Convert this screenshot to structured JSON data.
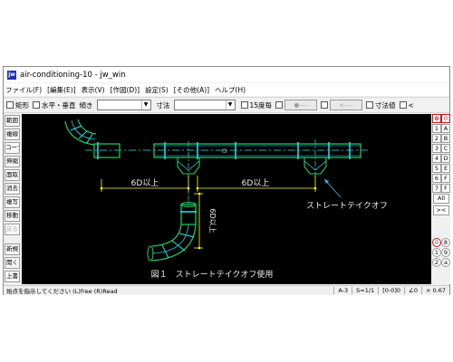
{
  "window": {
    "title": "air-conditioning-10 - jw_win",
    "icon_text": "jw"
  },
  "menu": [
    "ファイル(F)",
    "[編集(E)]",
    "表示(V)",
    "[作図(D)]",
    "設定(S)",
    "[その他(A)]",
    "ヘルプ(H)"
  ],
  "toolbar": {
    "rect_label": "矩形",
    "hv_label": "水平・垂直",
    "slope_label": "傾き",
    "dim_label": "寸法",
    "deg15_label": "15度毎",
    "btn_circle": "●----",
    "btn_arrow": "<----",
    "dimval_label": "寸法値",
    "last_label": "<"
  },
  "left_tools": [
    "範囲",
    "複線",
    "コーナー",
    "伸縮",
    "面取",
    "消去",
    "複写",
    "移動",
    "戻る",
    "新規",
    "開く",
    "上書"
  ],
  "right_tools": {
    "rows": [
      [
        "0",
        "0"
      ],
      [
        "1",
        "A"
      ],
      [
        "2",
        "B"
      ],
      [
        "3",
        "C"
      ],
      [
        "4",
        "D"
      ],
      [
        "5",
        "E"
      ],
      [
        "6",
        "F"
      ],
      [
        "7",
        "F"
      ]
    ],
    "all_label": "All",
    "cross_label": "><",
    "circle_rows": [
      [
        "0",
        "8"
      ],
      [
        "1",
        "9"
      ],
      [
        "2",
        "a"
      ]
    ]
  },
  "drawing": {
    "dim_left": "6D以上",
    "dim_right": "6D以上",
    "dim_vertical": "6D以上",
    "callout": "ストレートテイクオフ",
    "caption": "図１　ストレートテイクオフ使用",
    "center_mark": "D"
  },
  "status": {
    "message": "始点を指示してください (L)free (R)Read",
    "sheet": "A-3",
    "scale": "S=1/1",
    "layer": "[0-0]0",
    "angle": "∠0",
    "zoom": "× 0.67"
  },
  "colors": {
    "canvas_bg": "#000000",
    "pipe_cyan": "#22e6f0",
    "pipe_green": "#1fd160",
    "dim_yellow": "#ffff30",
    "text_white": "#f0f0f0",
    "callout_cyan": "#34b8f0"
  }
}
